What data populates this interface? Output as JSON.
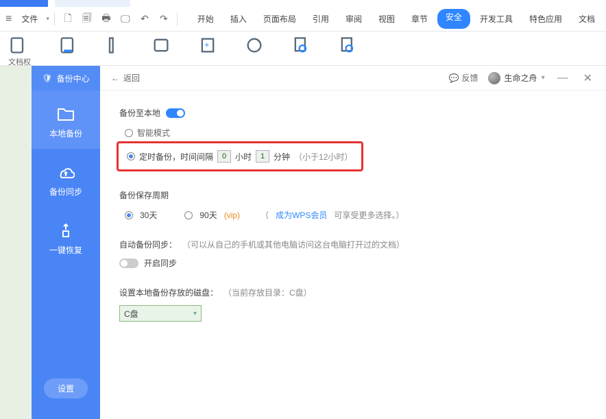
{
  "toolbar": {
    "file_label": "文件",
    "tabs": [
      "开始",
      "插入",
      "页面布局",
      "引用",
      "审阅",
      "视图",
      "章节",
      "安全",
      "开发工具",
      "特色应用",
      "文档"
    ],
    "active_tab": "安全",
    "ribbon_first_label": "文档权"
  },
  "sidebar": {
    "title": "备份中心",
    "items": [
      {
        "label": "本地备份"
      },
      {
        "label": "备份同步"
      },
      {
        "label": "一键恢复"
      }
    ],
    "settings_label": "设置"
  },
  "panel_header": {
    "back": "返回",
    "feedback": "反馈",
    "username": "生命之舟"
  },
  "settings": {
    "backup_local_title": "备份至本地",
    "smart_mode": "智能模式",
    "timed_backup_prefix": "定时备份，时间间隔",
    "hours_value": "0",
    "hours_unit": "小时",
    "minutes_value": "1",
    "minutes_unit": "分钟",
    "limit_hint": "（小于12小时）",
    "retention_title": "备份保存周期",
    "retention_30": "30天",
    "retention_90": "90天",
    "vip_tag": "(vip)",
    "become_vip_prefix": "（",
    "become_vip_link": "成为WPS会员",
    "become_vip_suffix": " 可享受更多选择。）",
    "auto_sync_title": "自动备份同步：",
    "auto_sync_hint": "（可以从自己的手机或其他电脑访问这台电脑打开过的文档）",
    "enable_sync": "开启同步",
    "disk_title": "设置本地备份存放的磁盘：",
    "disk_hint": "（当前存放目录：C盘）",
    "disk_selected": "C盘"
  }
}
